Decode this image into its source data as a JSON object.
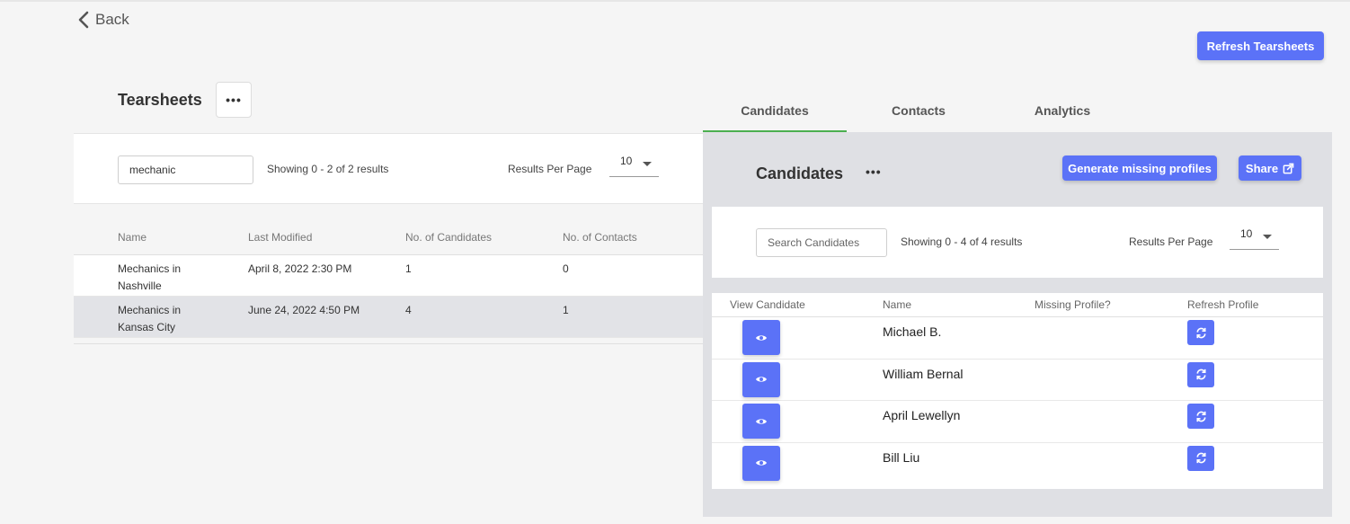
{
  "nav": {
    "back_label": "Back"
  },
  "header": {
    "refresh_tearsheets_label": "Refresh Tearsheets"
  },
  "tearsheets": {
    "title": "Tearsheets",
    "more_label": "•••",
    "search_value": "mechanic",
    "showing_text": "Showing 0 - 2 of 2 results",
    "results_per_page_label": "Results Per Page",
    "results_per_page_value": "10",
    "columns": [
      "Name",
      "Last Modified",
      "No. of Candidates",
      "No. of Contacts"
    ],
    "rows": [
      {
        "name": "Mechanics in Nashville",
        "modified": "April 8, 2022 2:30 PM",
        "candidates": "1",
        "contacts": "0",
        "selected": false
      },
      {
        "name": "Mechanics in Kansas City",
        "modified": "June 24, 2022 4:50 PM",
        "candidates": "4",
        "contacts": "1",
        "selected": true
      }
    ]
  },
  "tabs": [
    {
      "label": "Candidates",
      "active": true
    },
    {
      "label": "Contacts",
      "active": false
    },
    {
      "label": "Analytics",
      "active": false
    }
  ],
  "candidates_panel": {
    "title": "Candidates",
    "more_label": "•••",
    "generate_label": "Generate missing profiles",
    "share_label": "Share",
    "search_placeholder": "Search Candidates",
    "showing_text": "Showing 0 - 4 of 4 results",
    "results_per_page_label": "Results Per Page",
    "results_per_page_value": "10",
    "columns": [
      "View Candidate",
      "Name",
      "Missing Profile?",
      "Refresh Profile"
    ],
    "rows": [
      {
        "name": "Michael B."
      },
      {
        "name": "William Bernal"
      },
      {
        "name": "April Lewellyn"
      },
      {
        "name": "Bill Liu"
      }
    ]
  },
  "colors": {
    "primary": "#5b72f7",
    "tab_active_underline": "#4caf50",
    "panel_gray": "#dfe0e4",
    "selected_row": "#e2e3e7"
  },
  "icons": {
    "back": "chevron-left-icon",
    "view": "eye-icon",
    "refresh": "refresh-icon",
    "share": "external-share-icon"
  }
}
